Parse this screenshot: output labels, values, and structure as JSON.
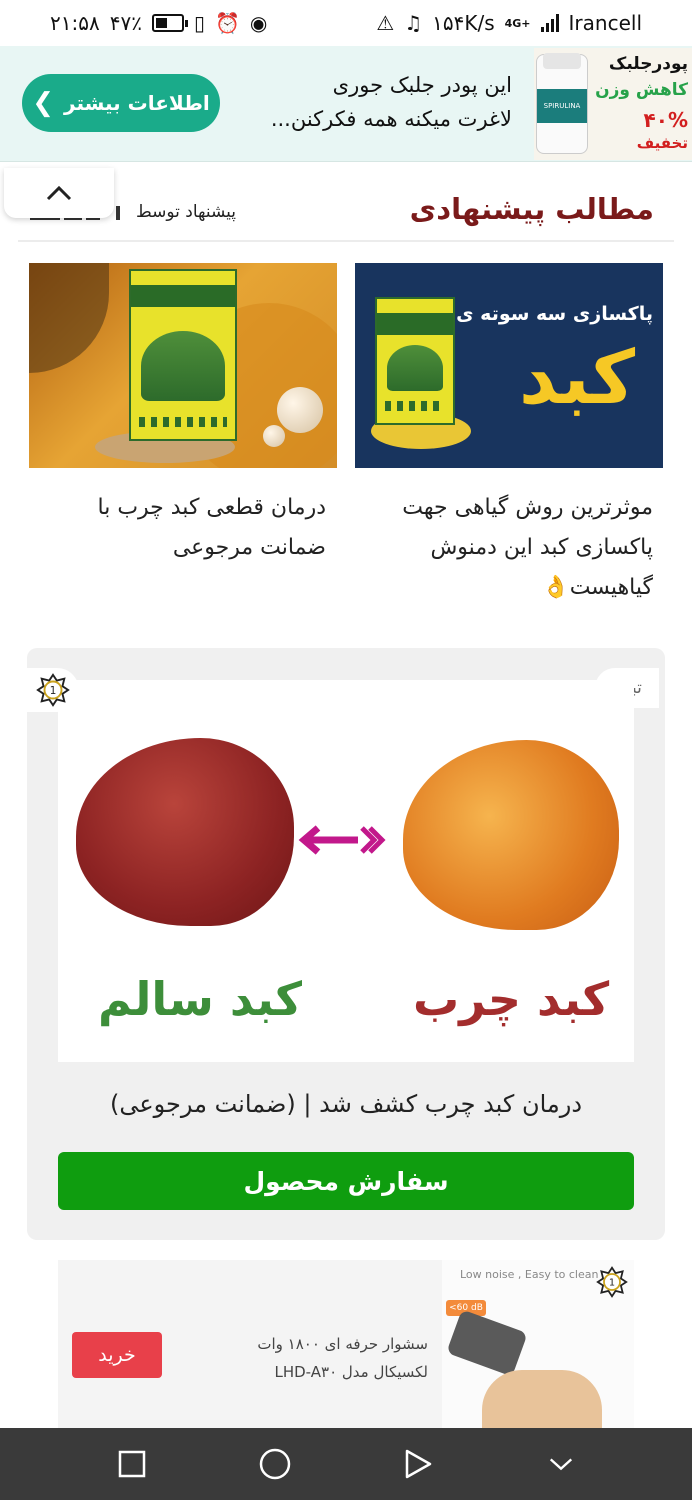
{
  "status_bar": {
    "time": "۲۱:۵۸",
    "battery": "۴۷٪",
    "battery_level": 0.47,
    "net_speed": "۱۵۴K/s",
    "network_type": "4G+",
    "carrier": "Irancell"
  },
  "ad_banner": {
    "button_label": "اطلاعات بیشتر",
    "text_line1": "این پودر جلبک جوری",
    "text_line2": "لاغرت میکنه همه فکرکنن...",
    "image": {
      "line1": "پودرجلبک",
      "line2": "کاهش وزن",
      "line3": "۴۰%",
      "line4": "تخفیف",
      "bottle_label": "SPIRULINA"
    }
  },
  "section": {
    "title": "مطالب پیشنهادی",
    "suggested_by": "پیشنهاد توسط"
  },
  "recommended": [
    {
      "title": "موثرترین روش گیاهی جهت پاکسازی کبد این دمنوش گیاهیست👌",
      "image_heading": "پاکسازی سه سوته ی",
      "image_word": "کبد"
    },
    {
      "title": "درمان قطعی کبد چرب با ضمانت مرجوعی"
    }
  ],
  "ad_card": {
    "ad_label": "تبلیغ",
    "badge_number": "1",
    "label_fatty": "کبد چرب",
    "label_healthy": "کبد سالم",
    "headline": "درمان کبد چرب کشف شد | (ضمانت مرجوعی)",
    "order_button": "سفارش محصول"
  },
  "ad2": {
    "image_text": "Low noise , Easy to clean",
    "badge_text": "<60 dB",
    "text_line1": "سشوار حرفه ای ۱۸۰۰ وات",
    "text_line2": "لکسیکال مدل LHD-A۳۰",
    "buy_button": "خرید"
  },
  "colors": {
    "accent_green": "#1aab8a",
    "title_red": "#7a1a1a",
    "order_green": "#0f9d0f",
    "buy_red": "#e8404a"
  },
  "nav_icons": [
    "recents-icon",
    "home-icon",
    "back-icon",
    "hide-nav-icon"
  ]
}
